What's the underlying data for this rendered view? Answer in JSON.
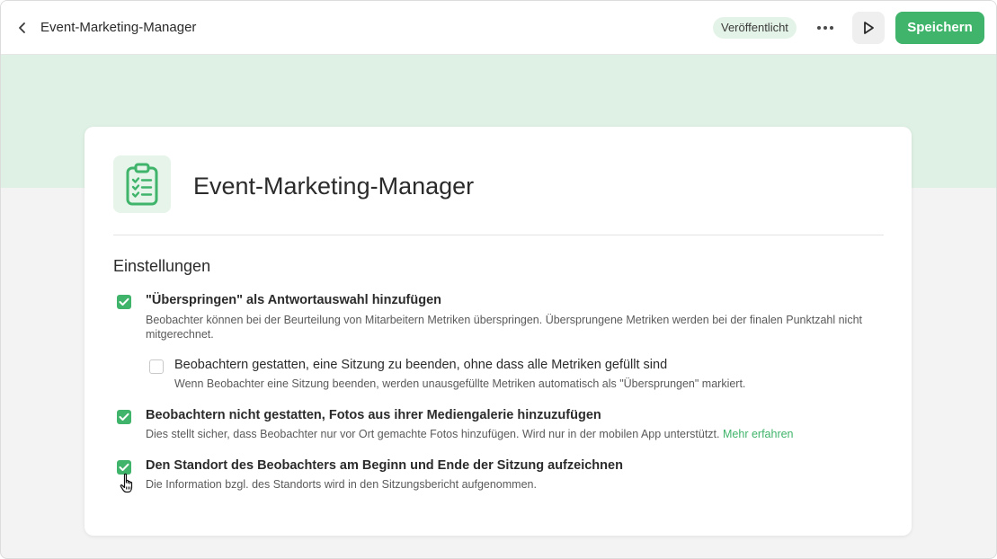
{
  "header": {
    "title": "Event-Marketing-Manager",
    "status": "Veröffentlicht",
    "save_label": "Speichern"
  },
  "card": {
    "title": "Event-Marketing-Manager",
    "section_title": "Einstellungen",
    "options": [
      {
        "label": "\"Überspringen\" als Antwortauswahl hinzufügen",
        "description": "Beobachter können bei der Beurteilung von Mitarbeitern Metriken überspringen. Übersprungene Metriken werden bei der finalen Punktzahl nicht mitgerechnet.",
        "checked": true
      },
      {
        "label": "Beobachtern gestatten, eine Sitzung zu beenden, ohne dass alle Metriken gefüllt sind",
        "description": "Wenn Beobachter eine Sitzung beenden, werden unausgefüllte Metriken automatisch als \"Übersprungen\" markiert.",
        "checked": false
      },
      {
        "label": "Beobachtern nicht gestatten, Fotos aus ihrer Mediengalerie hinzuzufügen",
        "description": "Dies stellt sicher, dass Beobachter nur vor Ort gemachte Fotos hinzufügen. Wird nur in der mobilen App unterstützt.",
        "link": "Mehr erfahren",
        "checked": true
      },
      {
        "label": "Den Standort des Beobachters am Beginn und Ende der Sitzung aufzeichnen",
        "description": "Die Information bzgl. des Standorts wird in den Sitzungsbericht aufgenommen.",
        "checked": true
      }
    ]
  },
  "icons": {
    "back": "chevron-left-icon",
    "more": "more-horizontal-icon",
    "play": "play-icon",
    "template": "clipboard-checklist-icon",
    "check": "check-icon",
    "cursor": "hand-pointer-icon"
  },
  "colors": {
    "accent": "#3fb46a",
    "band": "#dff1e4",
    "badge_bg": "#e4f3e8",
    "background": "#f3f3f3"
  }
}
